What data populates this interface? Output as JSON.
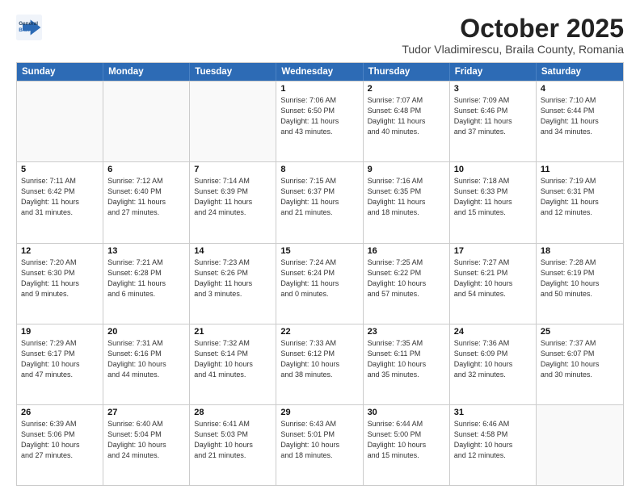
{
  "logo": {
    "line1": "General",
    "line2": "Blue"
  },
  "title": "October 2025",
  "subtitle": "Tudor Vladimirescu, Braila County, Romania",
  "header_days": [
    "Sunday",
    "Monday",
    "Tuesday",
    "Wednesday",
    "Thursday",
    "Friday",
    "Saturday"
  ],
  "weeks": [
    [
      {
        "day": "",
        "info": ""
      },
      {
        "day": "",
        "info": ""
      },
      {
        "day": "",
        "info": ""
      },
      {
        "day": "1",
        "info": "Sunrise: 7:06 AM\nSunset: 6:50 PM\nDaylight: 11 hours\nand 43 minutes."
      },
      {
        "day": "2",
        "info": "Sunrise: 7:07 AM\nSunset: 6:48 PM\nDaylight: 11 hours\nand 40 minutes."
      },
      {
        "day": "3",
        "info": "Sunrise: 7:09 AM\nSunset: 6:46 PM\nDaylight: 11 hours\nand 37 minutes."
      },
      {
        "day": "4",
        "info": "Sunrise: 7:10 AM\nSunset: 6:44 PM\nDaylight: 11 hours\nand 34 minutes."
      }
    ],
    [
      {
        "day": "5",
        "info": "Sunrise: 7:11 AM\nSunset: 6:42 PM\nDaylight: 11 hours\nand 31 minutes."
      },
      {
        "day": "6",
        "info": "Sunrise: 7:12 AM\nSunset: 6:40 PM\nDaylight: 11 hours\nand 27 minutes."
      },
      {
        "day": "7",
        "info": "Sunrise: 7:14 AM\nSunset: 6:39 PM\nDaylight: 11 hours\nand 24 minutes."
      },
      {
        "day": "8",
        "info": "Sunrise: 7:15 AM\nSunset: 6:37 PM\nDaylight: 11 hours\nand 21 minutes."
      },
      {
        "day": "9",
        "info": "Sunrise: 7:16 AM\nSunset: 6:35 PM\nDaylight: 11 hours\nand 18 minutes."
      },
      {
        "day": "10",
        "info": "Sunrise: 7:18 AM\nSunset: 6:33 PM\nDaylight: 11 hours\nand 15 minutes."
      },
      {
        "day": "11",
        "info": "Sunrise: 7:19 AM\nSunset: 6:31 PM\nDaylight: 11 hours\nand 12 minutes."
      }
    ],
    [
      {
        "day": "12",
        "info": "Sunrise: 7:20 AM\nSunset: 6:30 PM\nDaylight: 11 hours\nand 9 minutes."
      },
      {
        "day": "13",
        "info": "Sunrise: 7:21 AM\nSunset: 6:28 PM\nDaylight: 11 hours\nand 6 minutes."
      },
      {
        "day": "14",
        "info": "Sunrise: 7:23 AM\nSunset: 6:26 PM\nDaylight: 11 hours\nand 3 minutes."
      },
      {
        "day": "15",
        "info": "Sunrise: 7:24 AM\nSunset: 6:24 PM\nDaylight: 11 hours\nand 0 minutes."
      },
      {
        "day": "16",
        "info": "Sunrise: 7:25 AM\nSunset: 6:22 PM\nDaylight: 10 hours\nand 57 minutes."
      },
      {
        "day": "17",
        "info": "Sunrise: 7:27 AM\nSunset: 6:21 PM\nDaylight: 10 hours\nand 54 minutes."
      },
      {
        "day": "18",
        "info": "Sunrise: 7:28 AM\nSunset: 6:19 PM\nDaylight: 10 hours\nand 50 minutes."
      }
    ],
    [
      {
        "day": "19",
        "info": "Sunrise: 7:29 AM\nSunset: 6:17 PM\nDaylight: 10 hours\nand 47 minutes."
      },
      {
        "day": "20",
        "info": "Sunrise: 7:31 AM\nSunset: 6:16 PM\nDaylight: 10 hours\nand 44 minutes."
      },
      {
        "day": "21",
        "info": "Sunrise: 7:32 AM\nSunset: 6:14 PM\nDaylight: 10 hours\nand 41 minutes."
      },
      {
        "day": "22",
        "info": "Sunrise: 7:33 AM\nSunset: 6:12 PM\nDaylight: 10 hours\nand 38 minutes."
      },
      {
        "day": "23",
        "info": "Sunrise: 7:35 AM\nSunset: 6:11 PM\nDaylight: 10 hours\nand 35 minutes."
      },
      {
        "day": "24",
        "info": "Sunrise: 7:36 AM\nSunset: 6:09 PM\nDaylight: 10 hours\nand 32 minutes."
      },
      {
        "day": "25",
        "info": "Sunrise: 7:37 AM\nSunset: 6:07 PM\nDaylight: 10 hours\nand 30 minutes."
      }
    ],
    [
      {
        "day": "26",
        "info": "Sunrise: 6:39 AM\nSunset: 5:06 PM\nDaylight: 10 hours\nand 27 minutes."
      },
      {
        "day": "27",
        "info": "Sunrise: 6:40 AM\nSunset: 5:04 PM\nDaylight: 10 hours\nand 24 minutes."
      },
      {
        "day": "28",
        "info": "Sunrise: 6:41 AM\nSunset: 5:03 PM\nDaylight: 10 hours\nand 21 minutes."
      },
      {
        "day": "29",
        "info": "Sunrise: 6:43 AM\nSunset: 5:01 PM\nDaylight: 10 hours\nand 18 minutes."
      },
      {
        "day": "30",
        "info": "Sunrise: 6:44 AM\nSunset: 5:00 PM\nDaylight: 10 hours\nand 15 minutes."
      },
      {
        "day": "31",
        "info": "Sunrise: 6:46 AM\nSunset: 4:58 PM\nDaylight: 10 hours\nand 12 minutes."
      },
      {
        "day": "",
        "info": ""
      }
    ]
  ]
}
